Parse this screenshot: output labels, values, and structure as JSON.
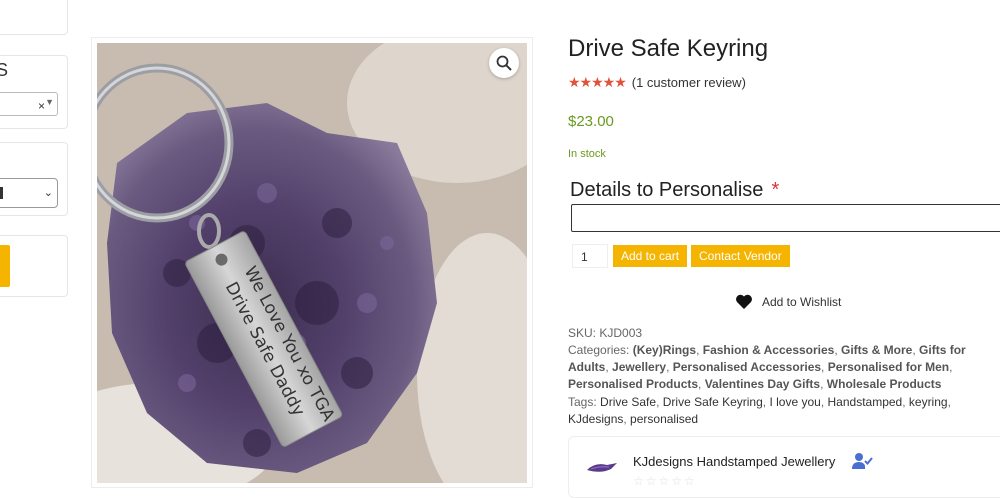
{
  "sidebar": {
    "partial_heading": "S",
    "select_clear": "×"
  },
  "gallery": {
    "image_alt": "Drive Safe Keyring",
    "tag_text_line1": "Drive Safe Daddy",
    "tag_text_line2": "We Love You xo TGA"
  },
  "product": {
    "title": "Drive Safe Keyring",
    "stars": "★★★★★",
    "review_text": "(1 customer review)",
    "price": "$23.00",
    "stock": "In stock",
    "details_label": "Details to Personalise",
    "required_mark": "*",
    "quantity": "1",
    "add_to_cart": "Add to cart",
    "contact_vendor": "Contact Vendor",
    "wishlist": "Add to Wishlist"
  },
  "meta": {
    "sku_label": "SKU:",
    "sku": "KJD003",
    "categories_label": "Categories:",
    "categories": [
      "(Key)Rings",
      "Fashion & Accessories",
      "Gifts & More",
      "Gifts for Adults",
      "Jewellery",
      "Personalised Accessories",
      "Personalised for Men",
      "Personalised Products",
      "Valentines Day Gifts",
      "Wholesale Products"
    ],
    "tags_label": "Tags:",
    "tags": [
      "Drive Safe",
      "Drive Safe Keyring",
      "I love you",
      "Handstamped",
      "keyring",
      "KJdesigns",
      "personalised"
    ]
  },
  "vendor": {
    "name": "KJdesigns Handstamped Jewellery",
    "stars": "☆☆☆☆☆"
  },
  "colors": {
    "accent_yellow": "#f5b400",
    "price_green": "#6a9a1f",
    "star_red": "#e0523a"
  }
}
